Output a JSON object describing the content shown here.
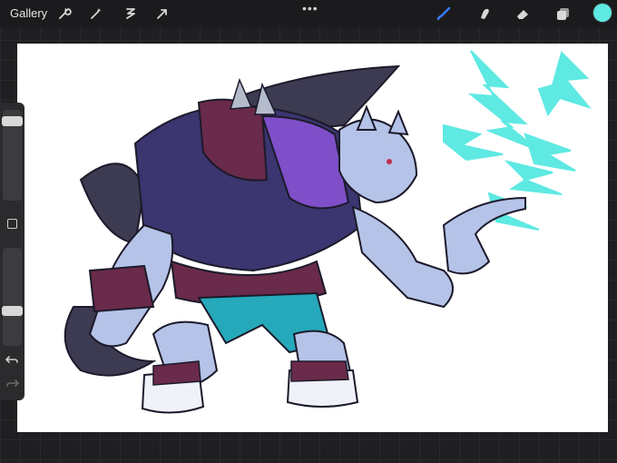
{
  "toolbar": {
    "gallery_label": "Gallery",
    "more_label": "•••",
    "left_icons": [
      "wrench-icon",
      "magic-wand-icon",
      "selection-icon",
      "transform-arrow-icon"
    ],
    "right_icons": [
      "brush-icon",
      "smudge-icon",
      "eraser-icon",
      "layers-icon"
    ],
    "current_color": "#5ee9e3",
    "active_tool_color": "#3b7cff"
  },
  "sidebar": {
    "brush_size_level": 0.93,
    "opacity_level": 0.44,
    "modify_button_icon": "square-icon",
    "undo_icon": "undo-arrow-icon",
    "redo_icon": "redo-arrow-icon"
  },
  "canvas": {
    "background": "#ffffff",
    "artwork": "werewolf-illustration"
  }
}
